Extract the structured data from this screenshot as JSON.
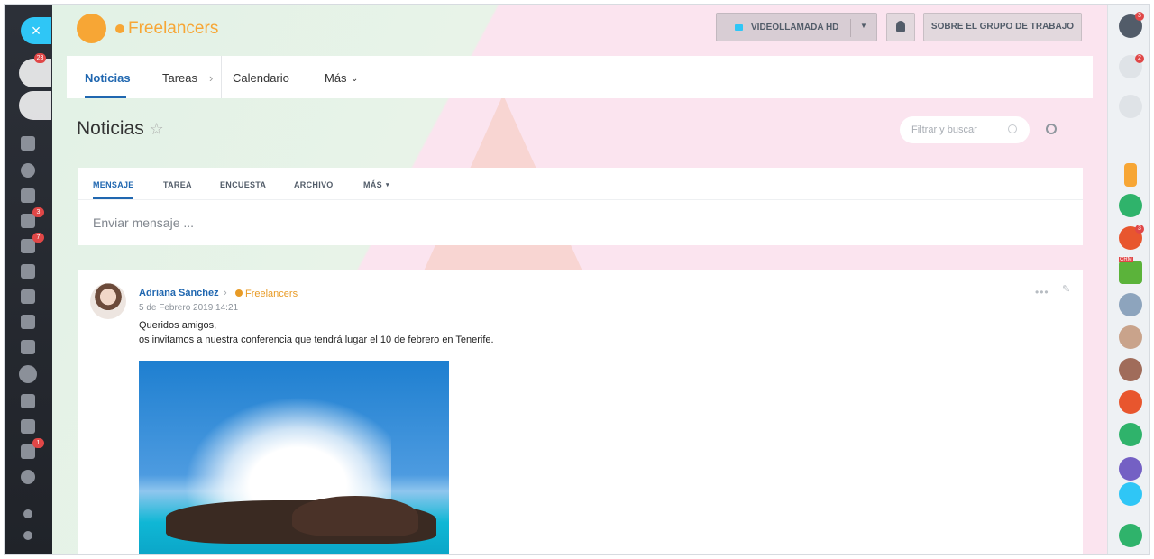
{
  "header": {
    "group_name": "Freelancers",
    "video_button": "VIDEOLLAMADA HD",
    "about_button": "SOBRE EL GRUPO DE TRABAJO"
  },
  "tabs": [
    {
      "label": "Noticias"
    },
    {
      "label": "Tareas"
    },
    {
      "label": "Calendario"
    },
    {
      "label": "Más"
    }
  ],
  "page": {
    "title": "Noticias",
    "filter_placeholder": "Filtrar y buscar"
  },
  "composer": {
    "tabs": [
      "MENSAJE",
      "TAREA",
      "ENCUESTA",
      "ARCHIVO",
      "MÁS"
    ],
    "placeholder": "Enviar mensaje ..."
  },
  "post": {
    "author": "Adriana Sánchez",
    "group": "Freelancers",
    "date": "5 de Febrero 2019 14:21",
    "lines": [
      "Queridos amigos,",
      "os invitamos a nuestra conferencia que tendrá lugar el 10 de febrero en Tenerife."
    ]
  },
  "left_sidebar": {
    "badges": [
      "23",
      "3",
      "7",
      "1"
    ]
  },
  "right_sidebar": {
    "help_badge": "3",
    "notifications_badge": "2",
    "group_badge": "3",
    "crm_label": "CRM"
  },
  "colors": {
    "accent": "#2067b0",
    "brand": "#f7a635",
    "sidebar_dark": "#2c3038"
  }
}
